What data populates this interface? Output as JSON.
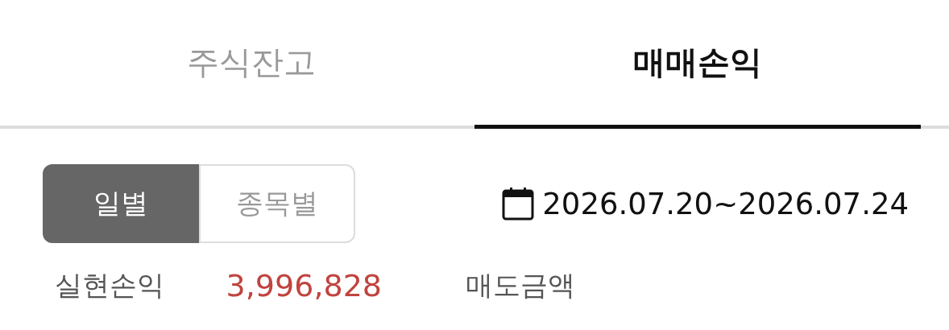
{
  "tabs": [
    {
      "label": "주식잔고",
      "selected": false
    },
    {
      "label": "매매손익",
      "selected": true
    }
  ],
  "segments": [
    {
      "label": "일별",
      "selected": true
    },
    {
      "label": "종목별",
      "selected": false
    }
  ],
  "date_range": "2026.07.20~2026.07.24",
  "summary": [
    {
      "label": "실현손익",
      "value": "3,996,828"
    },
    {
      "label": "매도금액"
    }
  ]
}
